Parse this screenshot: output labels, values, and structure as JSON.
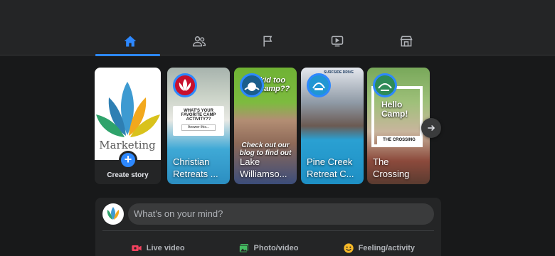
{
  "nav": {
    "tabs": [
      {
        "icon": "home-icon",
        "active": true
      },
      {
        "icon": "friends-icon",
        "active": false
      },
      {
        "icon": "flag-icon",
        "active": false
      },
      {
        "icon": "watch-icon",
        "active": false
      },
      {
        "icon": "marketplace-icon",
        "active": false
      }
    ]
  },
  "create_story": {
    "label": "Create story",
    "brand_text": "Marketing"
  },
  "stories": [
    {
      "title": "Christian Retreats ...",
      "card_text": "WHAT'S YOUR FAVORITE CAMP ACTIVITY??",
      "card_sub": "Answer this..."
    },
    {
      "title": "Lake Williamso...",
      "card_text": "kid too camp??",
      "card_sub": "Check out our blog to find out"
    },
    {
      "title": "Pine Creek Retreat C...",
      "card_text": "SURFSIDE DRIVE"
    },
    {
      "title": "The Crossing",
      "card_text": "Hello Camp!",
      "card_sub": "THE CROSSING"
    }
  ],
  "composer": {
    "placeholder": "What's on your mind?",
    "actions": [
      {
        "label": "Live video",
        "color": "#f3425f"
      },
      {
        "label": "Photo/video",
        "color": "#45bd62"
      },
      {
        "label": "Feeling/activity",
        "color": "#f7b928"
      }
    ]
  },
  "colors": {
    "accent": "#2d88ff",
    "background": "#18191a",
    "surface": "#242526"
  }
}
